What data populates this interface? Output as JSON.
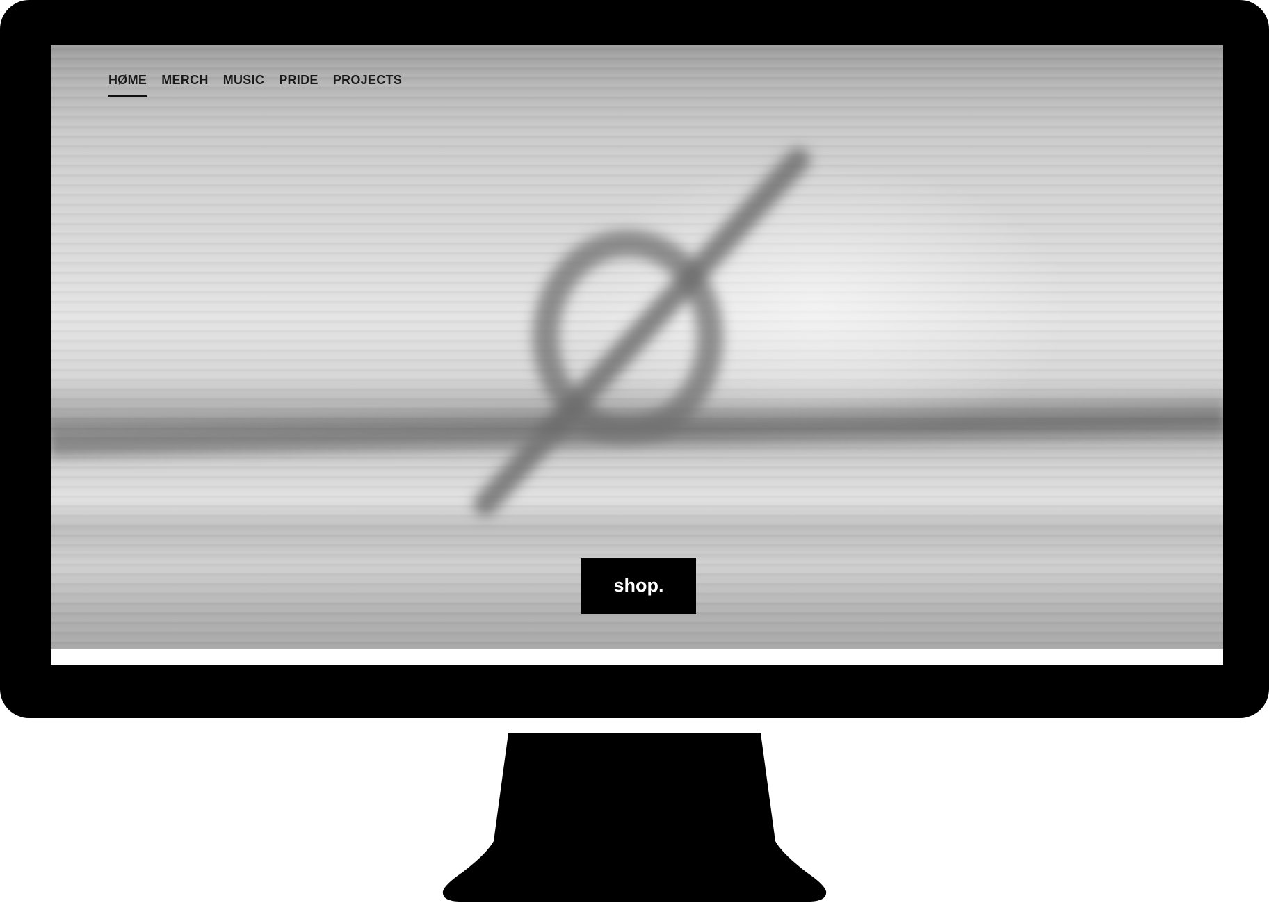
{
  "nav": {
    "items": [
      {
        "label": "HØME",
        "active": true
      },
      {
        "label": "MERCH",
        "active": false
      },
      {
        "label": "MUSIC",
        "active": false
      },
      {
        "label": "PRIDE",
        "active": false
      },
      {
        "label": "PROJECTS",
        "active": false
      }
    ]
  },
  "hero": {
    "logo_icon": "o-slash-icon",
    "cta_label": "shop."
  },
  "colors": {
    "bezel": "#000000",
    "button_bg": "#000000",
    "button_text": "#ffffff",
    "nav_text": "#1a1a1a"
  }
}
